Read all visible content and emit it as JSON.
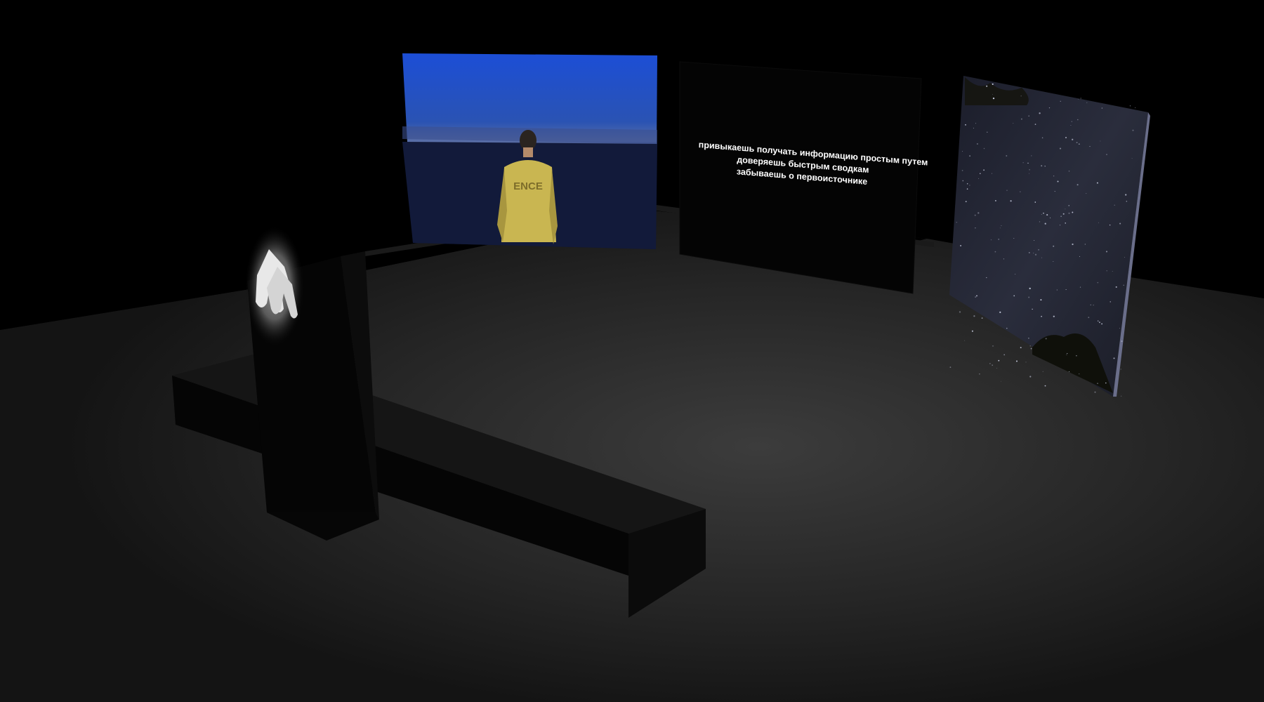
{
  "scene": {
    "screen_text": {
      "line1": "привыкаешь получать информацию простым путем",
      "line2": "доверяешь быстрым сводкам",
      "line3": "забываешь о первоисточнике"
    },
    "jacket_print": "ENCE",
    "colors": {
      "background": "#000000",
      "floor": "#222222",
      "floor_highlight": "#3a3a3a",
      "sky_top": "#1d4fd0",
      "sky_bottom": "#2f4a8a",
      "jacket": "#c9b651",
      "gloves": "#e8e8e8",
      "caption": "#ffffff"
    },
    "icons": [
      "hands-icon"
    ]
  }
}
